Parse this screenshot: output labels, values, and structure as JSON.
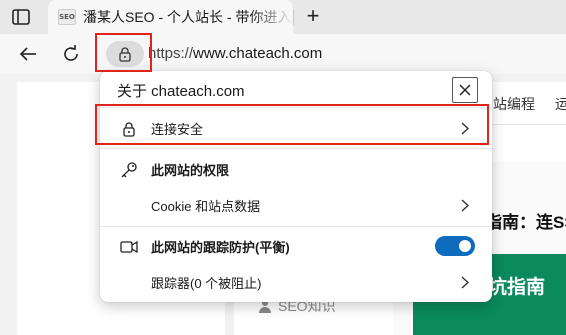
{
  "tab": {
    "favicon_text": "SEO",
    "title": "潘某人SEO - 个人站长 - 带你进入",
    "new_tab_symbol": "+"
  },
  "toolbar": {
    "url_scheme": "https://",
    "url_host": "www.chateach.com"
  },
  "page_bg": {
    "nav_item_1": "站编程",
    "nav_item_2": "运",
    "heading": "指南：连SS",
    "banner_text": "坑指南",
    "seo_link": "SEO知识"
  },
  "popup": {
    "title": "关于 chateach.com",
    "rows": [
      {
        "label": "连接安全",
        "icon": "lock-icon",
        "has_chevron": true
      },
      {
        "label": "此网站的权限",
        "icon": "key-icon",
        "bold": true
      },
      {
        "label": "Cookie 和站点数据",
        "has_chevron": true
      },
      {
        "label": "此网站的跟踪防护(平衡)",
        "icon": "camera-icon",
        "bold": true,
        "toggle_on": true
      },
      {
        "label": "跟踪器(0 个被阻止)",
        "has_chevron": true
      }
    ]
  },
  "colors": {
    "highlight": "#e2231a",
    "toggle_on": "#0f6cbd",
    "banner_green": "#0a8a5d"
  }
}
